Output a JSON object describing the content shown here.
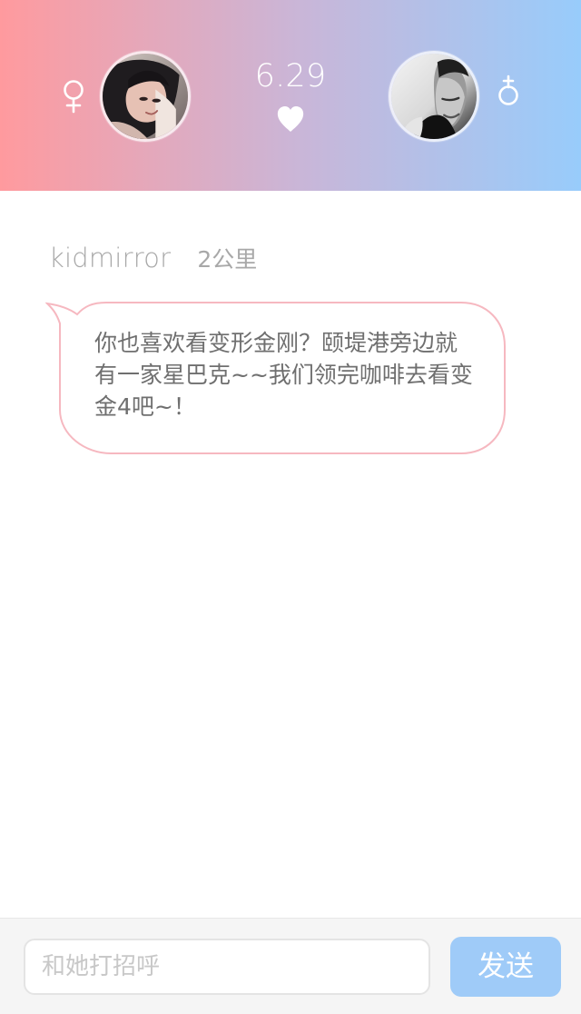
{
  "header": {
    "match_score": "6.29",
    "left_gender_icon": "female-symbol-icon",
    "right_gender_icon": "male-symbol-icon",
    "heart_icon": "heart-icon",
    "left_avatar": "female-avatar",
    "right_avatar": "male-avatar",
    "gradient_start": "#ff9a9e",
    "gradient_end": "#98ccfb"
  },
  "message": {
    "sender": "kidmirror",
    "distance": "2公里",
    "text": "你也喜欢看变形金刚？颐堤港旁边就有一家星巴克~~我们领完咖啡去看变金4吧~！"
  },
  "composer": {
    "placeholder": "和她打招呼",
    "value": "",
    "send_label": "发送"
  },
  "colors": {
    "bubble_border": "#f6b8c0",
    "text_primary": "#6f6f6f",
    "text_secondary": "#a8a8a8",
    "send_button": "#9fcbf8"
  }
}
